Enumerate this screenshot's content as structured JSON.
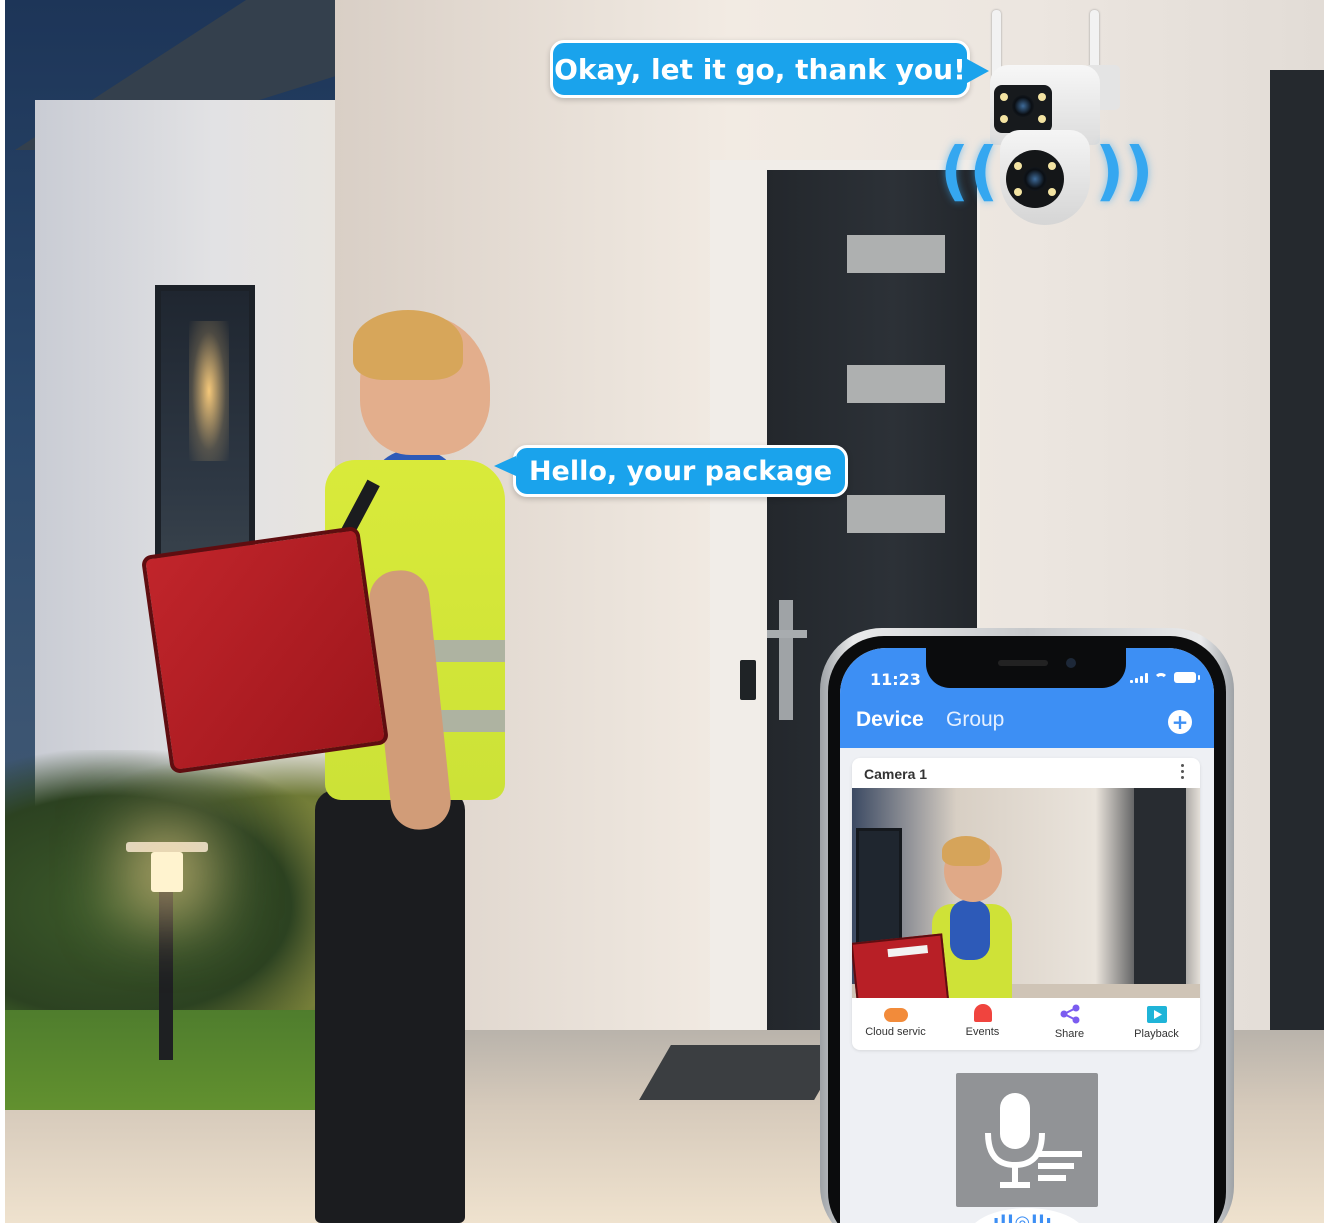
{
  "speech": {
    "camera_line": "Okay, let it go, thank you!",
    "courier_line": "Hello, your package"
  },
  "phone": {
    "status_bar": {
      "time": "11:23"
    },
    "header": {
      "tabs": [
        "Device",
        "Group"
      ],
      "add_icon": "plus-circle-icon"
    },
    "camera_card": {
      "title": "Camera 1",
      "actions": [
        {
          "label": "Cloud servic",
          "icon": "cloud-icon",
          "color": "#f28b3a"
        },
        {
          "label": "Events",
          "icon": "bell-icon",
          "color": "#f0443e"
        },
        {
          "label": "Share",
          "icon": "share-icon",
          "color": "#7b5cf0"
        },
        {
          "label": "Playback",
          "icon": "play-icon",
          "color": "#1fb4d8"
        }
      ]
    },
    "talk": {
      "icon": "microphone-icon"
    }
  },
  "colors": {
    "accent": "#3d8ff4",
    "bubble": "#1aa3ec",
    "signal_waves": "#35a7f0"
  }
}
